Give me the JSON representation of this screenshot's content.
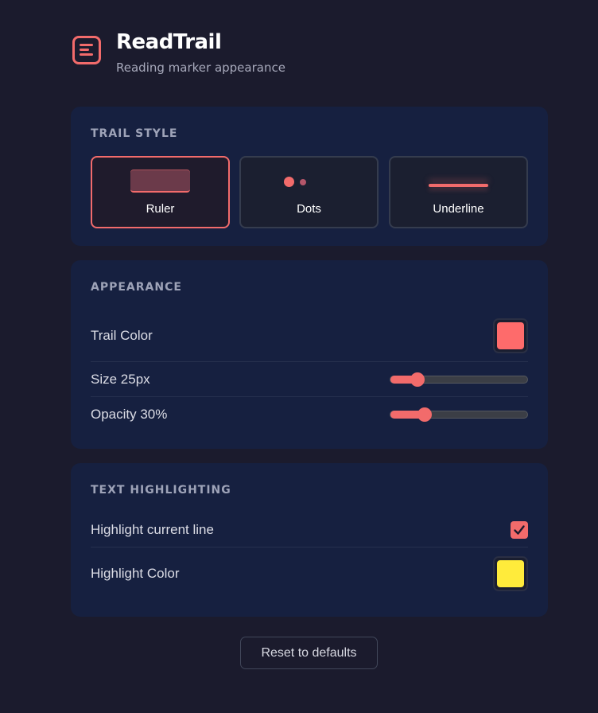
{
  "app": {
    "title": "ReadTrail",
    "subtitle": "Reading marker appearance",
    "accent": "#f26b6b"
  },
  "trail_style": {
    "title": "TRAIL STYLE",
    "selected": "Ruler",
    "options": [
      {
        "label": "Ruler",
        "icon": "ruler-preview-icon"
      },
      {
        "label": "Dots",
        "icon": "dots-preview-icon"
      },
      {
        "label": "Underline",
        "icon": "underline-preview-icon"
      }
    ]
  },
  "appearance": {
    "title": "APPEARANCE",
    "trail_color_label": "Trail Color",
    "trail_color": "#fe6b6b",
    "size_label": "Size 25px",
    "size_fraction": 0.2,
    "opacity_label": "Opacity 30%",
    "opacity_fraction": 0.25
  },
  "text_highlighting": {
    "title": "TEXT HIGHLIGHTING",
    "highlight_line_label": "Highlight current line",
    "highlight_line_checked": true,
    "highlight_color_label": "Highlight Color",
    "highlight_color": "#ffeb3b"
  },
  "reset_label": "Reset to defaults"
}
